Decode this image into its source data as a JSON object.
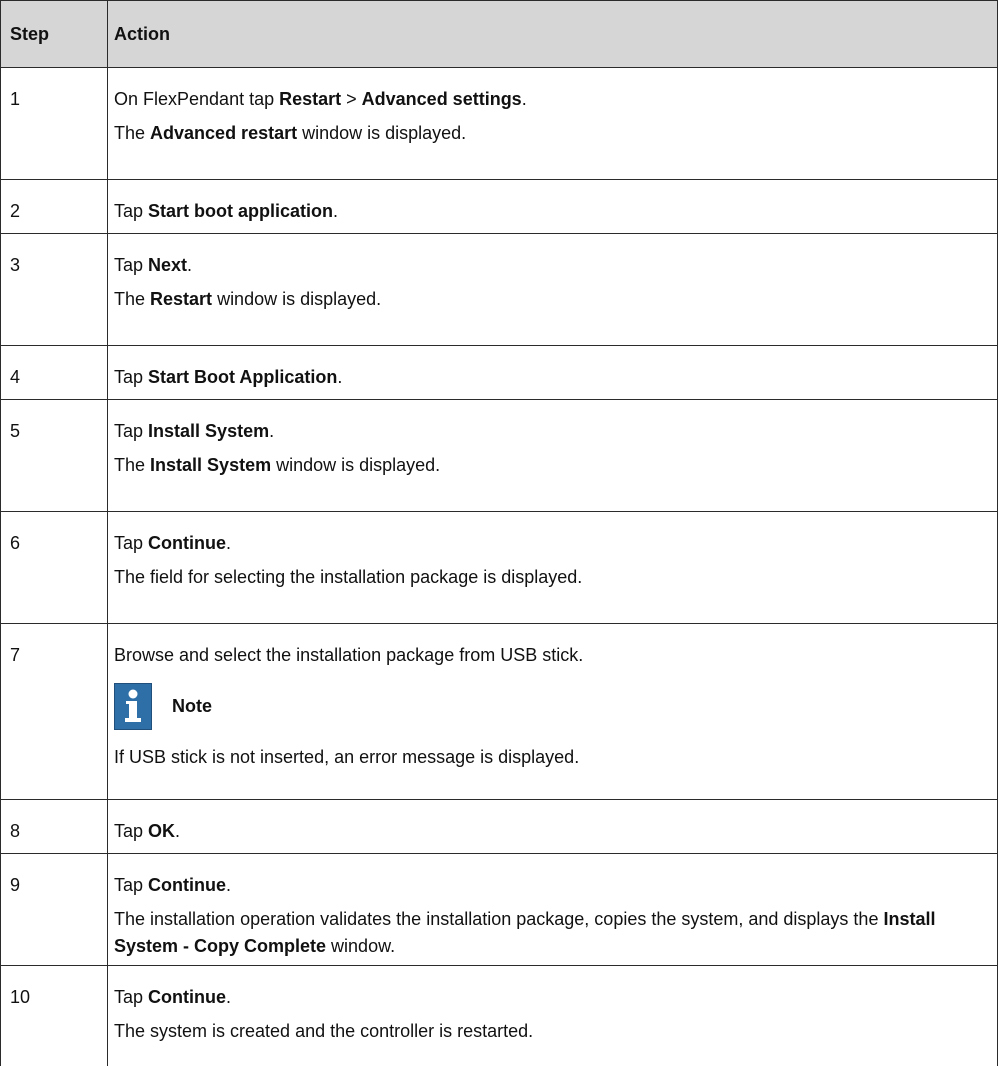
{
  "header": {
    "step": "Step",
    "action": "Action"
  },
  "rows": [
    {
      "step": "1",
      "lines": [
        [
          {
            "t": "On FlexPendant tap "
          },
          {
            "t": "Restart",
            "b": true
          },
          {
            "t": " > "
          },
          {
            "t": "Advanced settings",
            "b": true
          },
          {
            "t": "."
          }
        ],
        [
          {
            "t": "The "
          },
          {
            "t": "Advanced restart",
            "b": true
          },
          {
            "t": " window is displayed."
          }
        ]
      ]
    },
    {
      "step": "2",
      "lines": [
        [
          {
            "t": "Tap "
          },
          {
            "t": "Start boot application",
            "b": true
          },
          {
            "t": "."
          }
        ]
      ]
    },
    {
      "step": "3",
      "lines": [
        [
          {
            "t": "Tap "
          },
          {
            "t": "Next",
            "b": true
          },
          {
            "t": "."
          }
        ],
        [
          {
            "t": "The "
          },
          {
            "t": "Restart",
            "b": true
          },
          {
            "t": " window is displayed."
          }
        ]
      ]
    },
    {
      "step": "4",
      "lines": [
        [
          {
            "t": "Tap "
          },
          {
            "t": "Start Boot Application",
            "b": true
          },
          {
            "t": "."
          }
        ]
      ]
    },
    {
      "step": "5",
      "lines": [
        [
          {
            "t": "Tap "
          },
          {
            "t": "Install System",
            "b": true
          },
          {
            "t": "."
          }
        ],
        [
          {
            "t": "The "
          },
          {
            "t": "Install System",
            "b": true
          },
          {
            "t": " window is displayed."
          }
        ]
      ]
    },
    {
      "step": "6",
      "lines": [
        [
          {
            "t": "Tap "
          },
          {
            "t": "Continue",
            "b": true
          },
          {
            "t": "."
          }
        ],
        [
          {
            "t": "The field for selecting the installation package is displayed."
          }
        ]
      ]
    },
    {
      "step": "7",
      "lines": [
        [
          {
            "t": "Browse and select the installation package from USB stick."
          }
        ]
      ],
      "note": {
        "label": "Note",
        "icon": "info-icon",
        "text": "If USB stick is not inserted, an error message is displayed."
      }
    },
    {
      "step": "8",
      "lines": [
        [
          {
            "t": "Tap "
          },
          {
            "t": "OK",
            "b": true
          },
          {
            "t": "."
          }
        ]
      ]
    },
    {
      "step": "9",
      "lines": [
        [
          {
            "t": "Tap "
          },
          {
            "t": "Continue",
            "b": true
          },
          {
            "t": "."
          }
        ],
        [
          {
            "t": "The installation operation validates the installation package, copies the system, and displays the "
          },
          {
            "t": "Install System - Copy Complete",
            "b": true
          },
          {
            "t": " window."
          }
        ]
      ]
    },
    {
      "step": "10",
      "lines": [
        [
          {
            "t": "Tap "
          },
          {
            "t": "Continue",
            "b": true
          },
          {
            "t": "."
          }
        ],
        [
          {
            "t": "The system is created and the controller is restarted."
          }
        ]
      ]
    }
  ],
  "colors": {
    "header_bg": "#d6d6d6",
    "border": "#2b2b2b",
    "note_icon_bg": "#2f6fa8"
  }
}
